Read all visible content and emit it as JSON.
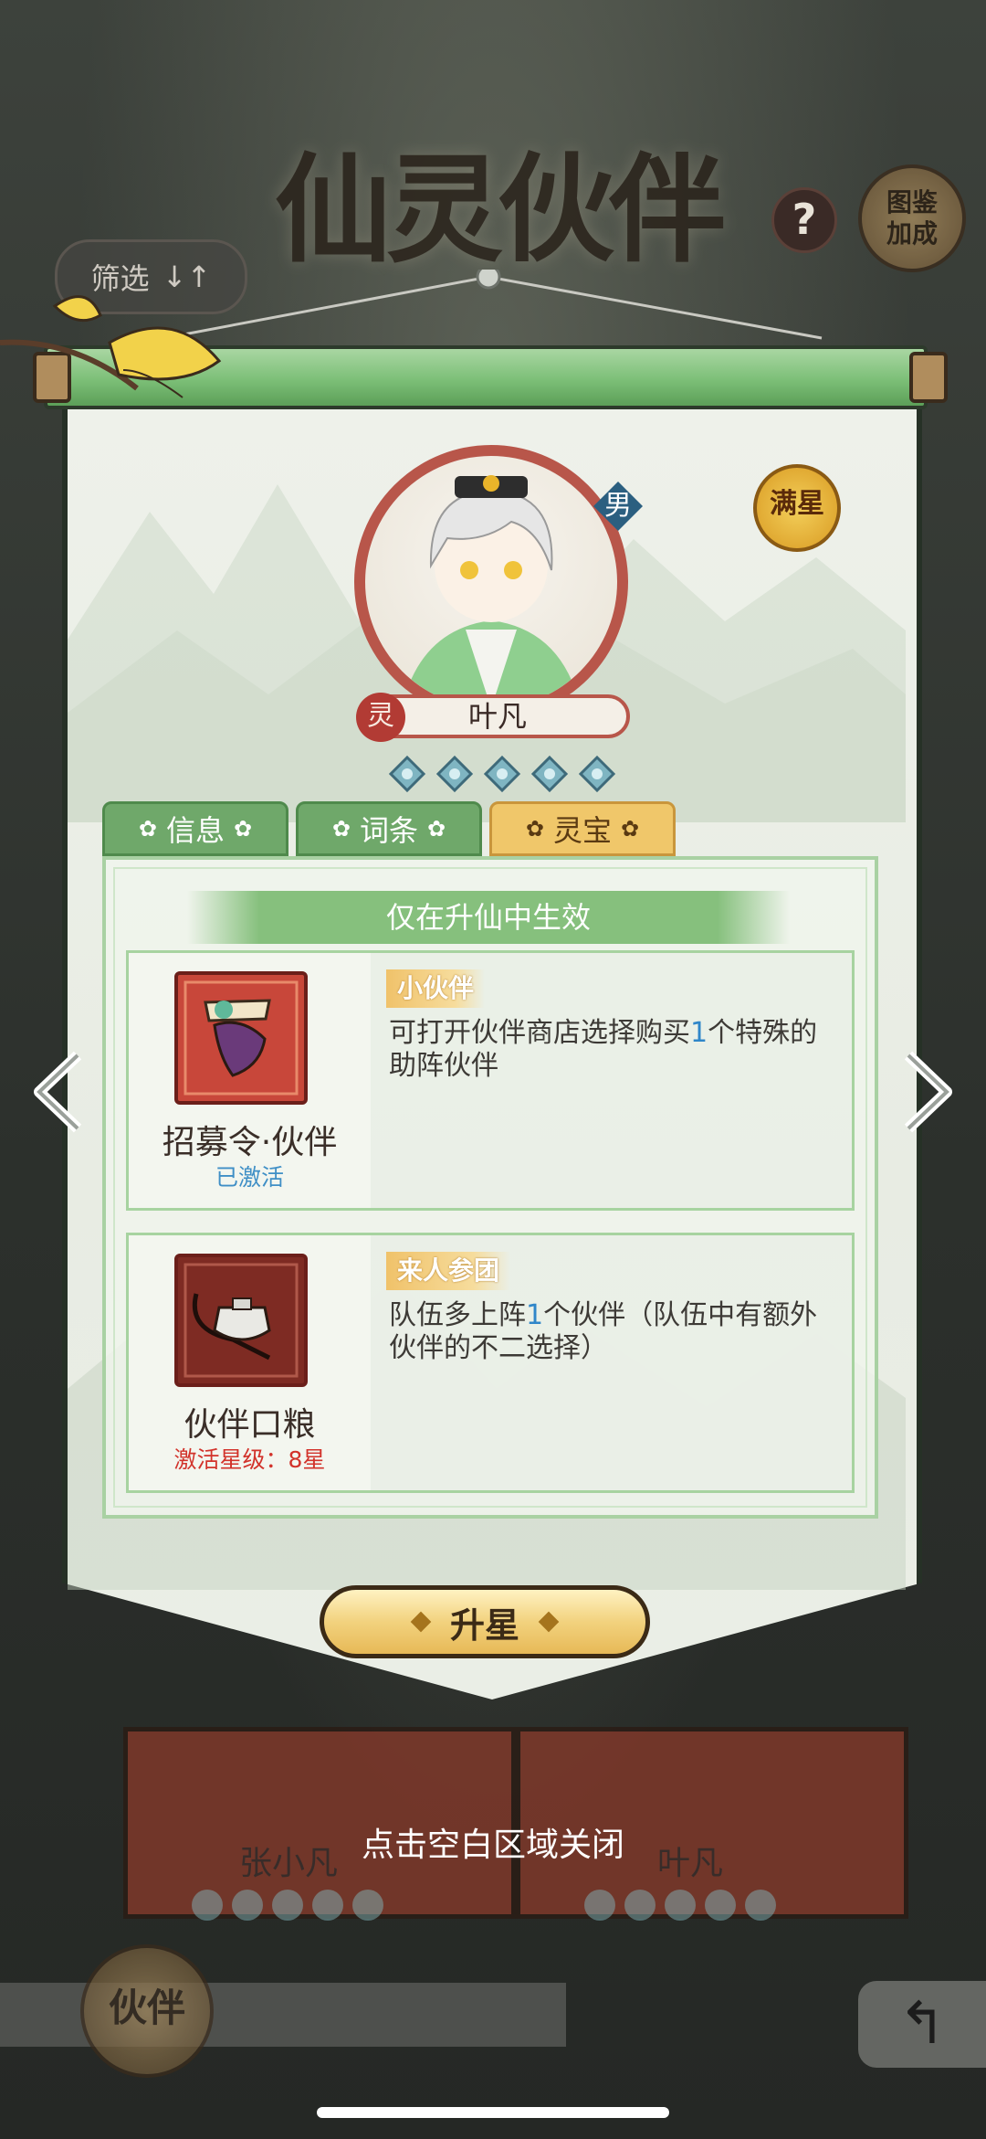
{
  "page_title": "仙灵伙伴",
  "header": {
    "help_icon": "?",
    "atlas_bonus": "图鉴\n加成",
    "filter_label": "筛选",
    "filter_sort_icon": "↓↑"
  },
  "character": {
    "gender": "男",
    "full_star_badge": "满星",
    "type_seal": "灵",
    "name": "叶凡",
    "star_gems": 5
  },
  "tabs": [
    {
      "label": "信息",
      "active": false
    },
    {
      "label": "词条",
      "active": false
    },
    {
      "label": "灵宝",
      "active": true
    }
  ],
  "treasures": {
    "banner": "仅在升仙中生效",
    "items": [
      {
        "name": "招募令·伙伴",
        "status": "已激活",
        "status_color": "#3f8fc6",
        "tag": "小伙伴",
        "desc_pre": "可打开伙伴商店选择购买",
        "desc_num": "1",
        "desc_post": "个特殊的助阵伙伴"
      },
      {
        "name": "伙伴口粮",
        "status": "激活星级：8星",
        "status_color": "#d2332b",
        "tag": "来人参团",
        "desc_pre": "队伍多上阵",
        "desc_num": "1",
        "desc_post": "个伙伴（队伍中有额外伙伴的不二选择）"
      }
    ]
  },
  "upgrade_button": "升星",
  "close_hint": "点击空白区域关闭",
  "background_cards": [
    {
      "name": "张小凡"
    },
    {
      "name": "叶凡"
    }
  ],
  "bottom": {
    "partner_badge": "伙伴",
    "back_icon": "↰"
  },
  "colors": {
    "accent_green": "#86c07d",
    "tab_active": "#f0c76a",
    "highlight_number": "#2f86c9"
  }
}
